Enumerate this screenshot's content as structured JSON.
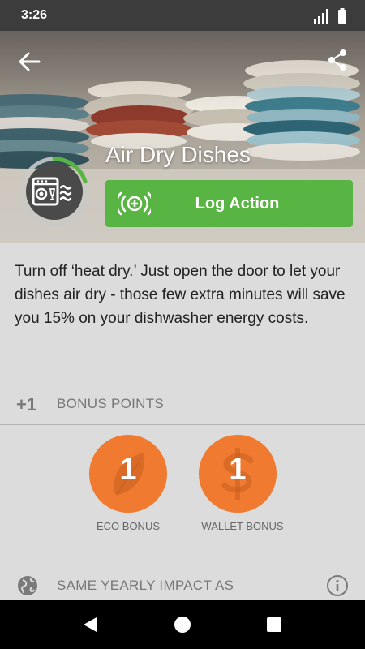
{
  "status": {
    "time": "3:26"
  },
  "action": {
    "title": "Air Dry Dishes",
    "log_label": "Log Action",
    "description": "Turn off ‘heat dry.’ Just open the door to let your dishes air dry - those few extra minutes will save you 15% on your dishwasher energy costs.",
    "progress_fraction": 0.2
  },
  "bonus": {
    "plus_label": "+1",
    "header_label": "BONUS POINTS",
    "eco": {
      "value": "1",
      "caption": "ECO BONUS"
    },
    "wallet": {
      "value": "1",
      "caption": "WALLET BONUS"
    }
  },
  "impact": {
    "label": "SAME YEARLY IMPACT AS"
  },
  "colors": {
    "accent_green": "#58b443",
    "bonus_orange": "#f07a30"
  },
  "icons": [
    "back-arrow-icon",
    "share-icon",
    "dishwasher-icon",
    "log-signal-icon",
    "leaf-icon",
    "dollar-icon",
    "globe-icon",
    "info-icon",
    "nav-back-icon",
    "nav-home-icon",
    "nav-recents-icon"
  ]
}
